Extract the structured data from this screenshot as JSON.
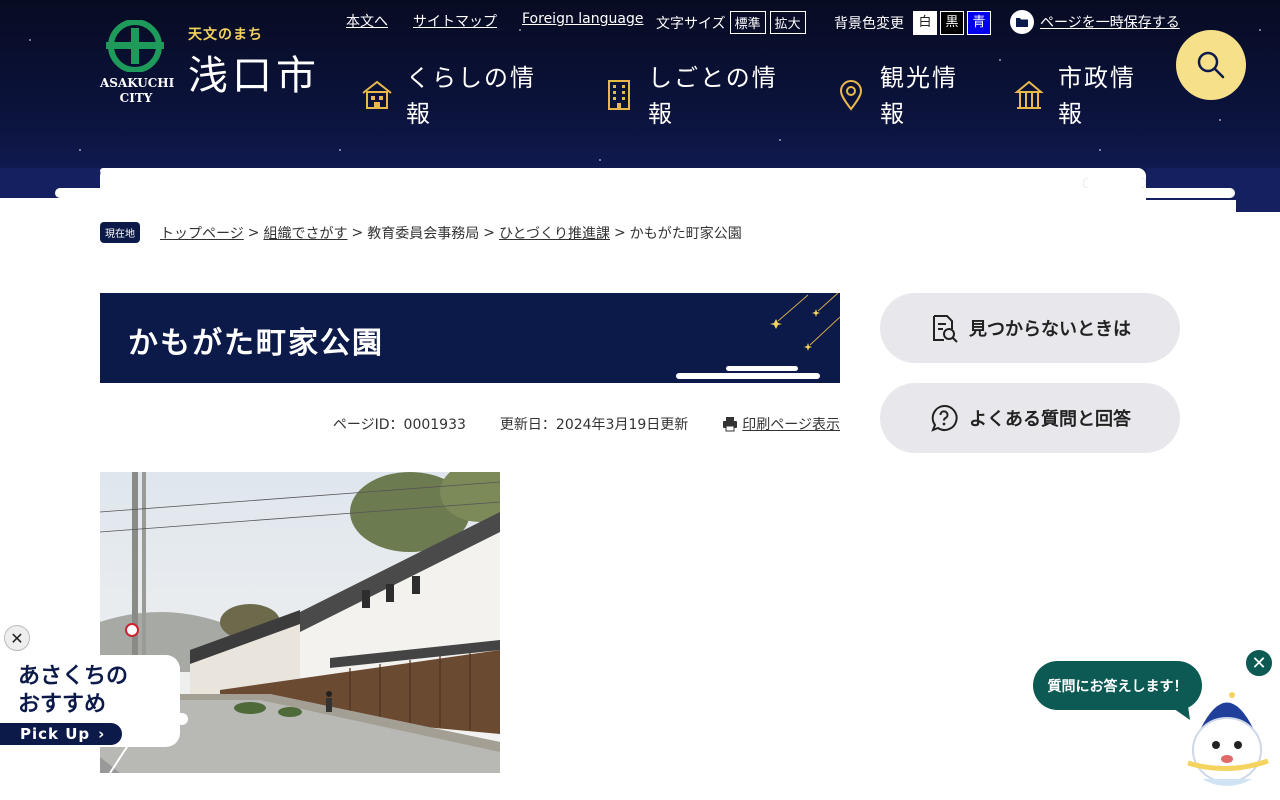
{
  "header": {
    "logo": {
      "tagline": "天文のまち",
      "city_name": "浅口市",
      "city_en_1": "ASAKUCHI",
      "city_en_2": "CITY"
    },
    "top_links": [
      {
        "label": "本文へ"
      },
      {
        "label": "サイトマップ"
      },
      {
        "label": "Foreign language"
      }
    ],
    "font_size": {
      "label": "文字サイズ",
      "standard": "標準",
      "large": "拡大"
    },
    "bg_color": {
      "label": "背景色変更",
      "white": "白",
      "black": "黒",
      "blue": "青"
    },
    "save_page": {
      "label": "ページを一時保存する",
      "icon": "folder-icon"
    },
    "search": {
      "icon": "search-icon"
    },
    "global_nav": [
      {
        "label": "くらしの情報",
        "icon": "house-icon"
      },
      {
        "label": "しごとの情報",
        "icon": "building-icon"
      },
      {
        "label": "観光情報",
        "icon": "map-pin-icon"
      },
      {
        "label": "市政情報",
        "icon": "city-hall-icon"
      }
    ]
  },
  "breadcrumb": {
    "here_label": "現在地",
    "items": [
      "トップページ",
      "組織でさがす",
      "教育委員会事務局",
      "ひとづくり推進課",
      "かもがた町家公園"
    ]
  },
  "page": {
    "title": "かもがた町家公園",
    "page_id": "ページID：0001933",
    "updated": "更新日：2024年3月19日更新",
    "print_label": "印刷ページ表示"
  },
  "sidebar": {
    "buttons": [
      {
        "label": "見つからないときは",
        "icon": "document-search-icon"
      },
      {
        "label": "よくある質問と回答",
        "icon": "question-bubble-icon"
      }
    ]
  },
  "pickup": {
    "line1": "あさくちの",
    "line2": "おすすめ",
    "pick_label": "Pick Up",
    "close": "✕"
  },
  "chatbot": {
    "bubble": "質問にお答えします！",
    "close": "✕"
  },
  "colors": {
    "navy": "#0c1a4a",
    "accent_yellow": "#f7e08a",
    "chat_green": "#0c5a53"
  }
}
